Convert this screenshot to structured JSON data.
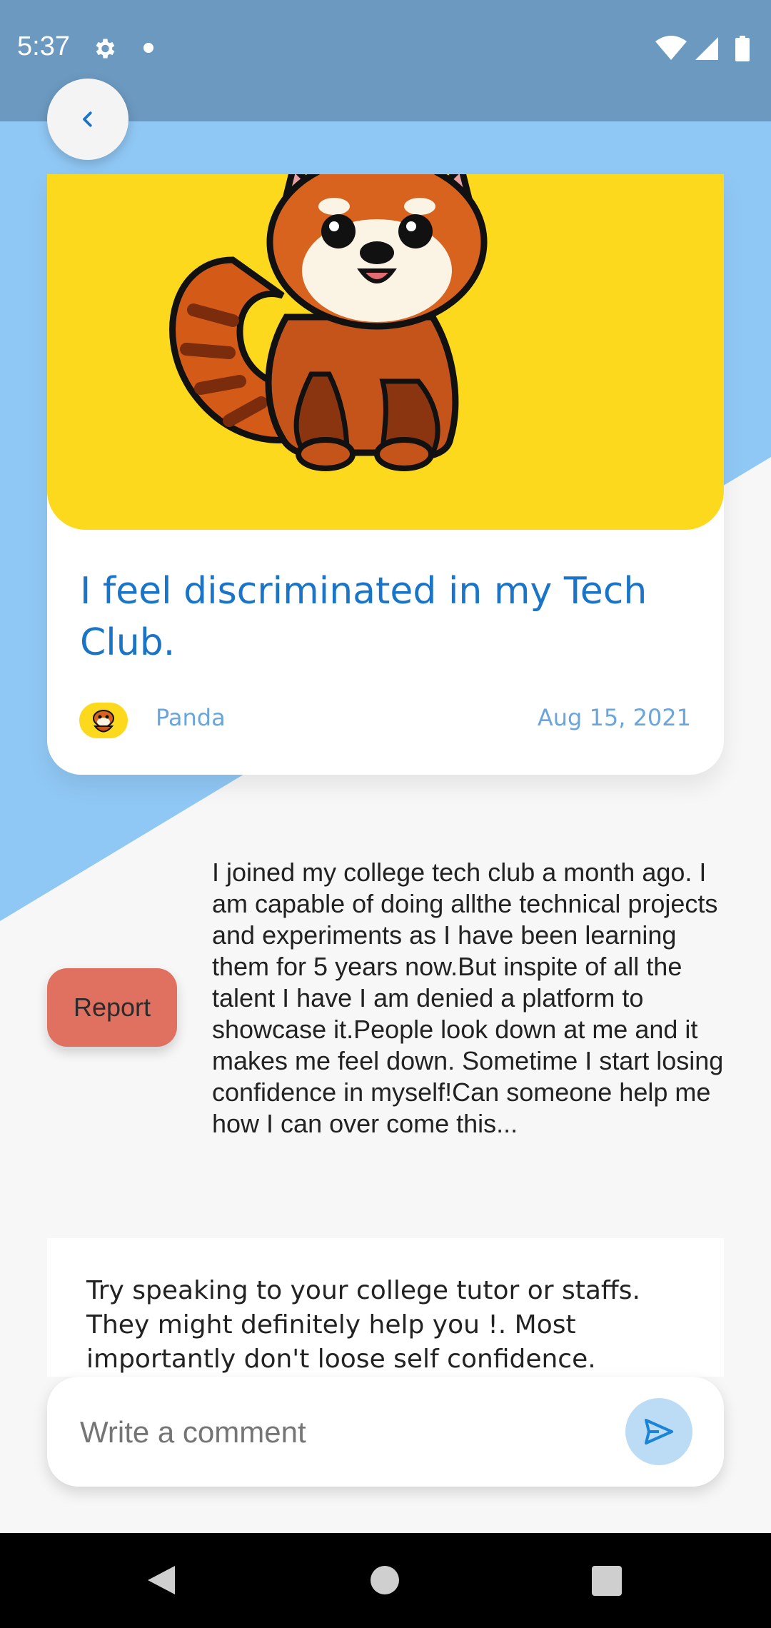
{
  "status_bar": {
    "time": "5:37",
    "icons": [
      "gear-icon",
      "notification-dot-icon",
      "wifi-icon",
      "signal-icon",
      "battery-icon"
    ]
  },
  "colors": {
    "accent": "#1a74c8",
    "status_bar": "#6c99c0",
    "light_blue_bg": "#90c8f5",
    "card_yellow": "#fdd91d",
    "report": "#e0705f",
    "send_button": "#bcdcf6"
  },
  "post": {
    "title": "I feel discriminated in my Tech Club.",
    "author": "Panda",
    "date": "Aug 15, 2021",
    "image": "red-panda-illustration",
    "body": "I joined my college tech club a month ago. I am capable of doing allthe technical projects and experiments as I have been learning them for 5 years now.But inspite of all the talent I have I am denied a platform to showcase it.People look down at me and it makes me feel down. Sometime I start losing confidence in myself!Can someone help me how I can over come this..."
  },
  "actions": {
    "report_label": "Report"
  },
  "comments": [
    {
      "text": "Try speaking to your college tutor or staffs. They might definitely help you !. Most importantly don't loose self confidence."
    }
  ],
  "composer": {
    "placeholder": "Write a comment",
    "send_icon": "send-icon"
  },
  "nav": {
    "icons": [
      "back-triangle-icon",
      "home-circle-icon",
      "recents-square-icon"
    ]
  }
}
